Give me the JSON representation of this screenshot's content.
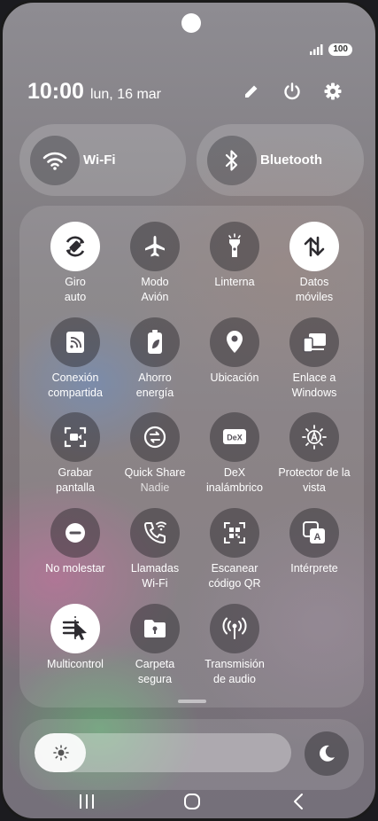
{
  "status_bar": {
    "battery": "100",
    "signal_icon": "signal-bars-icon"
  },
  "header": {
    "time": "10:00",
    "date": "lun, 16 mar",
    "edit_icon": "pencil-icon",
    "power_icon": "power-icon",
    "settings_icon": "gear-icon"
  },
  "connectivity": {
    "wifi": {
      "label": "Wi-Fi",
      "icon": "wifi-icon"
    },
    "bluetooth": {
      "label": "Bluetooth",
      "icon": "bluetooth-icon"
    }
  },
  "tiles": [
    {
      "label": "Giro\nauto",
      "icon": "auto-rotate-icon",
      "active": true
    },
    {
      "label": "Modo\nAvión",
      "icon": "airplane-icon",
      "active": false
    },
    {
      "label": "Linterna",
      "icon": "flashlight-icon",
      "active": false
    },
    {
      "label": "Datos\nmóviles",
      "icon": "mobile-data-icon",
      "active": true
    },
    {
      "label": "Conexión\ncompartida",
      "icon": "hotspot-icon",
      "active": false
    },
    {
      "label": "Ahorro\nenergía",
      "icon": "power-saving-icon",
      "active": false
    },
    {
      "label": "Ubicación",
      "icon": "location-icon",
      "active": false
    },
    {
      "label": "Enlace a\nWindows",
      "icon": "link-to-windows-icon",
      "active": false
    },
    {
      "label": "Grabar\npantalla",
      "icon": "screen-record-icon",
      "active": false
    },
    {
      "label": "Quick Share",
      "sublabel": "Nadie",
      "icon": "quick-share-icon",
      "active": false
    },
    {
      "label": "DeX\ninalámbrico",
      "icon": "dex-icon",
      "active": false
    },
    {
      "label": "Protector de la\nvista",
      "icon": "eye-comfort-icon",
      "active": false
    },
    {
      "label": "No molestar",
      "icon": "do-not-disturb-icon",
      "active": false
    },
    {
      "label": "Llamadas\nWi-Fi",
      "icon": "wifi-calling-icon",
      "active": false
    },
    {
      "label": "Escanear\ncódigo QR",
      "icon": "qr-scan-icon",
      "active": false
    },
    {
      "label": "Intérprete",
      "icon": "interpreter-icon",
      "active": false
    },
    {
      "label": "Multicontrol",
      "icon": "multi-control-icon",
      "active": true
    },
    {
      "label": "Carpeta\nsegura",
      "icon": "secure-folder-icon",
      "active": false
    },
    {
      "label": "Transmisión\nde audio",
      "icon": "audio-broadcast-icon",
      "active": false
    }
  ],
  "brightness": {
    "level": 0.2,
    "sun_icon": "brightness-icon",
    "night_icon": "moon-icon"
  },
  "nav_bar": {
    "recents": "recents-icon",
    "home": "home-icon",
    "back": "back-icon"
  }
}
